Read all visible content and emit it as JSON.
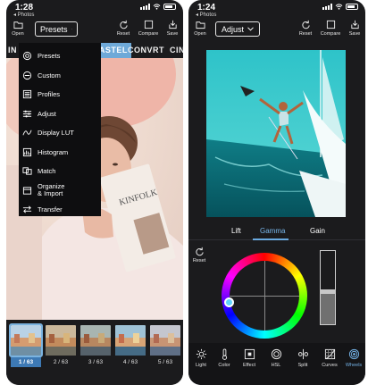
{
  "left_phone": {
    "status": {
      "time": "1:28",
      "back": "◂ Photos"
    },
    "toolbar": {
      "open": "Open",
      "dropdown": "Presets",
      "reset": "Reset",
      "compare": "Compare",
      "save": "Save"
    },
    "tabs": [
      "IN",
      "PASTEL",
      "CONVRT",
      "CINE"
    ],
    "active_tab": "PASTEL",
    "menu": [
      {
        "label": "Presets",
        "icon": "presets-icon"
      },
      {
        "label": "Custom",
        "icon": "custom-icon"
      },
      {
        "label": "Profiles",
        "icon": "profiles-icon"
      },
      {
        "label": "Adjust",
        "icon": "adjust-icon"
      },
      {
        "label": "Display LUT",
        "icon": "display-lut-icon"
      },
      {
        "label": "Histogram",
        "icon": "histogram-icon"
      },
      {
        "label": "Match",
        "icon": "match-icon"
      },
      {
        "label": "Organize\n& Import",
        "icon": "organize-icon"
      },
      {
        "label": "Transfer",
        "icon": "transfer-icon"
      }
    ],
    "thumbnails": [
      "1 / 63",
      "2 / 63",
      "3 / 63",
      "4 / 63",
      "5 / 63"
    ],
    "active_thumbnail": "1 / 63"
  },
  "right_phone": {
    "status": {
      "time": "1:24",
      "back": "◂ Photos"
    },
    "toolbar": {
      "open": "Open",
      "dropdown": "Adjust",
      "reset": "Reset",
      "compare": "Compare",
      "save": "Save"
    },
    "wheel_tabs": [
      "Lift",
      "Gamma",
      "Gain"
    ],
    "active_wheel_tab": "Gamma",
    "reset_label": "Reset",
    "slider_level": 0.45,
    "bottom_tools": [
      "Light",
      "Color",
      "Effect",
      "HSL",
      "Split",
      "Curves",
      "Wheels"
    ],
    "active_tool": "Wheels"
  },
  "colors": {
    "app_bg": "#1b1b1d",
    "accent": "#6ea9d8",
    "menu_bg": "#0e0e10"
  }
}
